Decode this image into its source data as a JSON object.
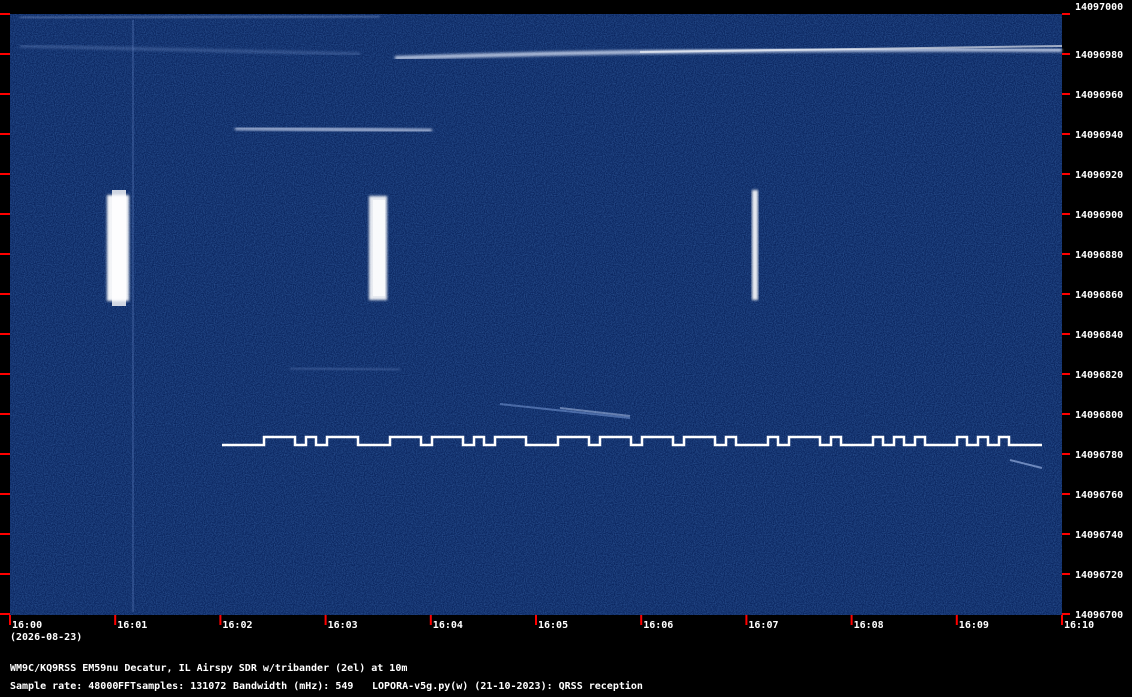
{
  "freq_labels": [
    "14097000",
    "14096980",
    "14096960",
    "14096940",
    "14096920",
    "14096900",
    "14096880",
    "14096860",
    "14096840",
    "14096820",
    "14096800",
    "14096780",
    "14096760",
    "14096740",
    "14096720",
    "14096700"
  ],
  "time_labels": [
    "16:00",
    "16:01",
    "16:02",
    "16:03",
    "16:04",
    "16:05",
    "16:06",
    "16:07",
    "16:08",
    "16:09",
    "16:10"
  ],
  "date_label": "(2026-08-23)",
  "station_line": "WM9C/KQ9RSS EM59nu Decatur, IL  Airspy SDR w/tribander (2el) at 10m",
  "info": {
    "sample_rate": "Sample rate: 48000",
    "fft_samples": "FFTsamples: 131072",
    "bandwidth": "Bandwidth (mHz): 549",
    "software": "LOPORA-v5g.py(w) (21-10-2023): QRSS reception"
  },
  "colors": {
    "background": "#0c2a66",
    "tick": "#ff0000",
    "signal": "#ffffff"
  }
}
